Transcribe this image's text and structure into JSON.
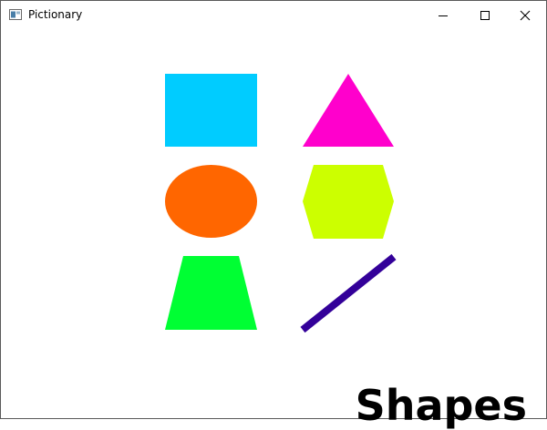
{
  "window": {
    "title": "Pictionary"
  },
  "title_bar_buttons": {
    "minimize_icon": "minimize-icon",
    "maximize_icon": "maximize-icon",
    "close_icon": "close-icon"
  },
  "canvas": {
    "label": "Shapes",
    "shapes": [
      {
        "name": "rectangle",
        "color": "#00ccff"
      },
      {
        "name": "triangle",
        "color": "#ff00cc"
      },
      {
        "name": "ellipse",
        "color": "#ff6600"
      },
      {
        "name": "hexagon",
        "color": "#ccff00"
      },
      {
        "name": "trapezoid",
        "color": "#00ff33"
      },
      {
        "name": "line",
        "color": "#330099"
      }
    ]
  }
}
